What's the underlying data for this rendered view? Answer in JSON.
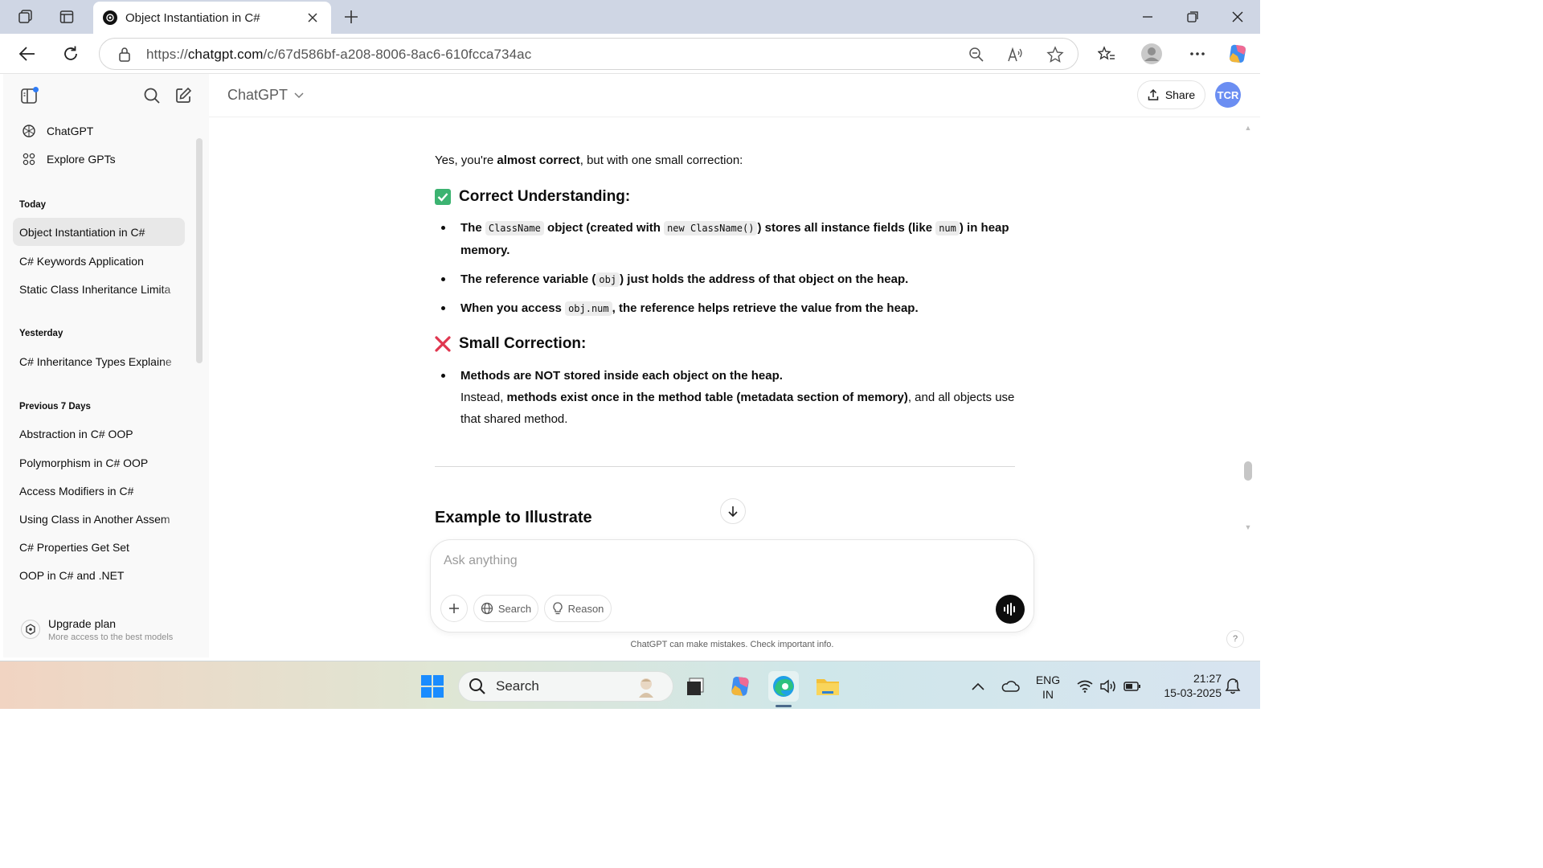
{
  "browser": {
    "tab_title": "Object Instantiation in C#",
    "url_prefix": "https://",
    "url_domain": "chatgpt.com",
    "url_path": "/c/67d586bf-a208-8006-8ac6-610fcca734ac"
  },
  "sidebar": {
    "nav": [
      {
        "label": "ChatGPT",
        "icon": "openai-logo-icon"
      },
      {
        "label": "Explore GPTs",
        "icon": "grid-icon"
      }
    ],
    "sections": [
      {
        "title": "Today",
        "items": [
          "Object Instantiation in C#",
          "C# Keywords Application",
          "Static Class Inheritance Limita"
        ]
      },
      {
        "title": "Yesterday",
        "items": [
          "C# Inheritance Types Explaine"
        ]
      },
      {
        "title": "Previous 7 Days",
        "items": [
          "Abstraction in C# OOP",
          "Polymorphism in C# OOP",
          "Access Modifiers in C#",
          "Using Class in Another Assem",
          "C# Properties Get Set",
          "OOP in C# and .NET"
        ]
      }
    ],
    "upgrade": {
      "title": "Upgrade plan",
      "subtitle": "More access to the best models"
    }
  },
  "header": {
    "model": "ChatGPT",
    "share_label": "Share",
    "avatar_initials": "TCR"
  },
  "message": {
    "intro_a": "Yes, you're ",
    "intro_b": "almost correct",
    "intro_c": ", but with one small correction:",
    "section1_title": "Correct Understanding:",
    "b1_a": "The ",
    "b1_code1": "ClassName",
    "b1_b": " object (created with ",
    "b1_code2": "new ClassName()",
    "b1_c": ") stores all instance fields (like ",
    "b1_code3": "num",
    "b1_d": ") in heap memory.",
    "b2_a": "The reference variable (",
    "b2_code": "obj",
    "b2_b": ") just holds the address of that object on the heap.",
    "b3_a": "When you access ",
    "b3_code": "obj.num",
    "b3_b": ", the reference helps retrieve the value from the heap.",
    "section2_title": "Small Correction:",
    "c1_bold": "Methods are NOT stored inside each object on the heap.",
    "c1_a": "Instead, ",
    "c1_b": "methods exist once in the method table (metadata section of memory)",
    "c1_c": ", and all objects use that shared method.",
    "example_title": "Example to Illustrate"
  },
  "composer": {
    "placeholder": "Ask anything",
    "search_label": "Search",
    "reason_label": "Reason"
  },
  "disclaimer": "ChatGPT can make mistakes. Check important info.",
  "taskbar": {
    "search_label": "Search",
    "lang_line1": "ENG",
    "lang_line2": "IN",
    "time": "21:27",
    "date": "15-03-2025"
  },
  "colors": {
    "check_green": "#3cb371",
    "cross_red": "#e0364f",
    "avatar_blue": "#6b8ef2"
  }
}
